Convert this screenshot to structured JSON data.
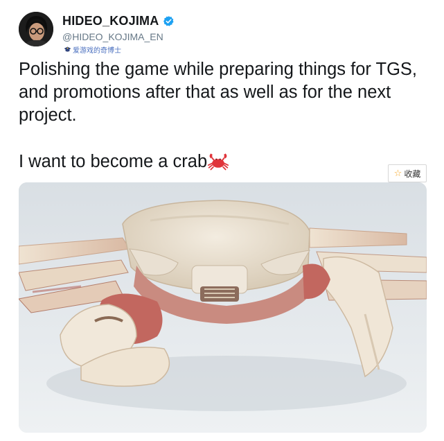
{
  "user": {
    "display_name": "HIDEO_KOJIMA",
    "handle": "@HIDEO_KOJIMA_EN",
    "verified": true,
    "avatar_icon": "person-with-glasses-avatar"
  },
  "watermark": {
    "text": "爱游戏的奇博士",
    "icon": "graduation-cap-icon"
  },
  "tweet": {
    "paragraph1": "Polishing the game while preparing things for TGS, and promotions after that as well as for the next project.",
    "paragraph2": "I want to become a crab",
    "emoji": "crab-emoji"
  },
  "favorite_button": {
    "label": "收藏",
    "icon": "star-outline-icon"
  },
  "media": {
    "subject": "crab-photo"
  },
  "colors": {
    "text": "#14171a",
    "secondary": "#657786",
    "verified": "#1da1f2",
    "crab": "#e0343a"
  }
}
